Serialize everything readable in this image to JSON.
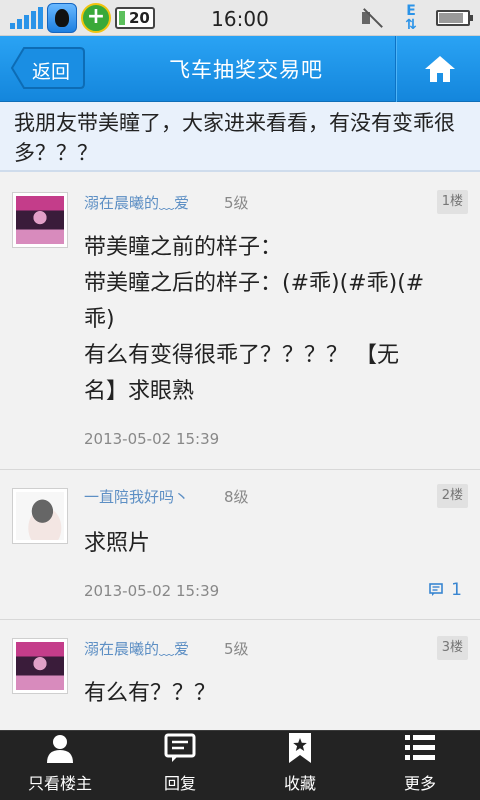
{
  "status_bar": {
    "time": "16:00",
    "badge": "20"
  },
  "header": {
    "back_label": "返回",
    "title": "飞车抽奖交易吧"
  },
  "thread": {
    "subject": "我朋友带美瞳了，大家进来看看，有没有变乖很多？？？"
  },
  "posts": [
    {
      "author": "溺在晨曦的﹏爱",
      "level": "5级",
      "floor": "1楼",
      "lines": [
        "带美瞳之前的样子：",
        "带美瞳之后的样子：(#乖)(#乖)(#",
        "乖)",
        "有么有变得很乖了？？？？ 【无",
        "名】求眼熟"
      ],
      "time": "2013-05-02 15:39"
    },
    {
      "author": "一直陪我好吗丶",
      "level": "8级",
      "floor": "2楼",
      "lines": [
        "求照片"
      ],
      "time": "2013-05-02 15:39",
      "reply_count": "1"
    },
    {
      "author": "溺在晨曦的﹏爱",
      "level": "5级",
      "floor": "3楼",
      "lines": [
        "有么有？？？"
      ]
    }
  ],
  "bottom_bar": {
    "items": [
      {
        "label": "只看楼主",
        "icon": "person-icon"
      },
      {
        "label": "回复",
        "icon": "reply-icon"
      },
      {
        "label": "收藏",
        "icon": "bookmark-icon"
      },
      {
        "label": "更多",
        "icon": "more-list-icon"
      }
    ]
  },
  "colors": {
    "accent": "#1a8fe6",
    "username": "#5d8fc4",
    "bar_bg": "#232323"
  }
}
